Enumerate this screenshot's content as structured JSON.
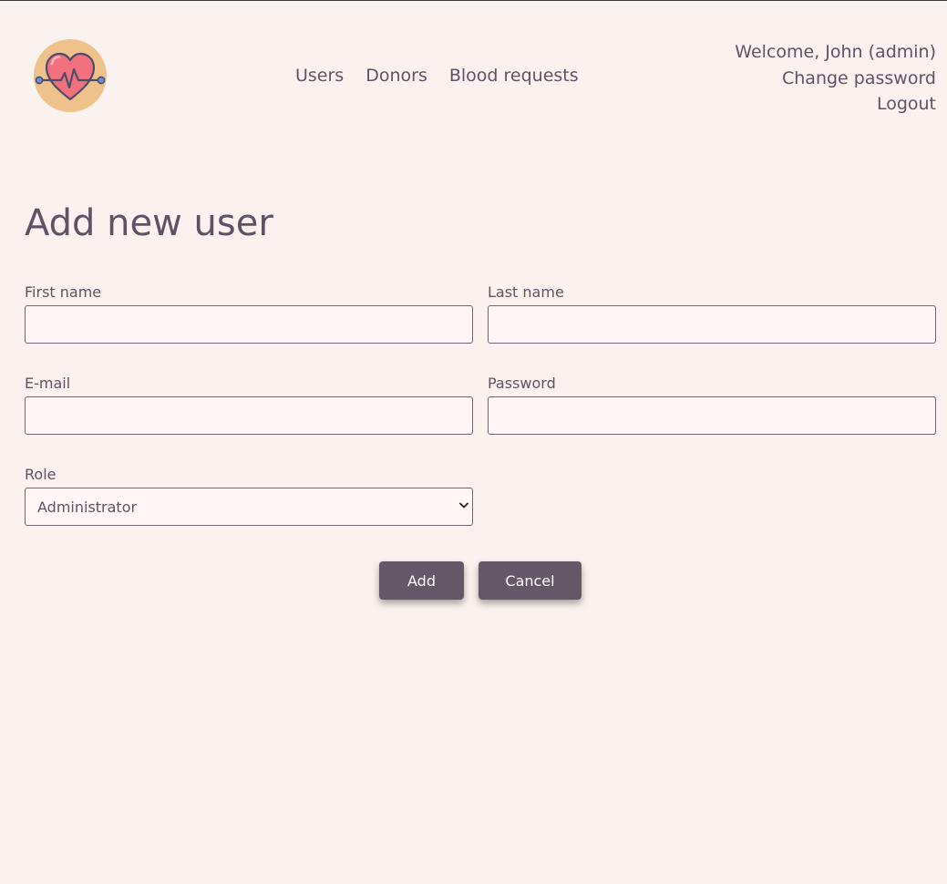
{
  "logo": {
    "icon": "heart-pulse-icon"
  },
  "nav": {
    "users": "Users",
    "donors": "Donors",
    "blood_requests": "Blood requests"
  },
  "user_menu": {
    "welcome": "Welcome, John (admin)",
    "change_password": "Change password",
    "logout": "Logout"
  },
  "page_title": "Add new user",
  "form": {
    "first_name": {
      "label": "First name",
      "value": ""
    },
    "last_name": {
      "label": "Last name",
      "value": ""
    },
    "email": {
      "label": "E-mail",
      "value": ""
    },
    "password": {
      "label": "Password",
      "value": ""
    },
    "role": {
      "label": "Role",
      "selected": "Administrator"
    }
  },
  "buttons": {
    "add": "Add",
    "cancel": "Cancel"
  },
  "colors": {
    "background": "#faf2ee",
    "text": "#5f5266",
    "button": "#645868",
    "input_background": "#fff6f6",
    "logo_circle": "#efc28b",
    "heart": "#f2717e"
  }
}
